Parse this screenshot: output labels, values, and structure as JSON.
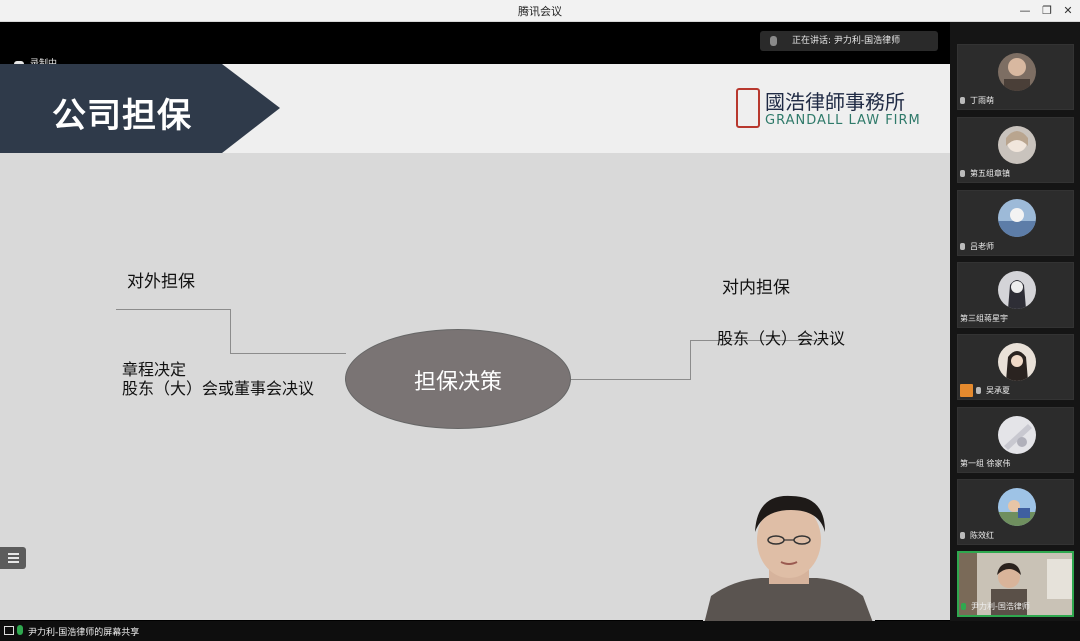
{
  "window": {
    "title": "腾讯会议"
  },
  "meeting": {
    "speaking_label": "正在讲话: 尹力利-国浩律师",
    "recording_label": "录制中",
    "share_status": "尹力利-国浩律师的屏幕共享"
  },
  "slide": {
    "title": "公司担保",
    "logo_cn": "國浩律師事務所",
    "logo_en": "GRANDALL LAW FIRM",
    "center": "担保决策",
    "left_heading": "对外担保",
    "left_line1": "章程决定",
    "left_line2": "股东（大）会或董事会决议",
    "right_heading": "对内担保",
    "right_line1": "股东（大）会决议"
  },
  "participants": [
    {
      "name": "丁雨萌"
    },
    {
      "name": "第五组章镇"
    },
    {
      "name": "吕老师"
    },
    {
      "name": "第三组蒋星宇"
    },
    {
      "name": "吴承夏"
    },
    {
      "name": "第一组 徐家伟"
    },
    {
      "name": "陈效红"
    },
    {
      "name": "尹力利-国浩律师"
    }
  ],
  "colors": {
    "banner": "#2f3a4a",
    "active_border": "#2fa84f",
    "seal": "#b8382e"
  }
}
